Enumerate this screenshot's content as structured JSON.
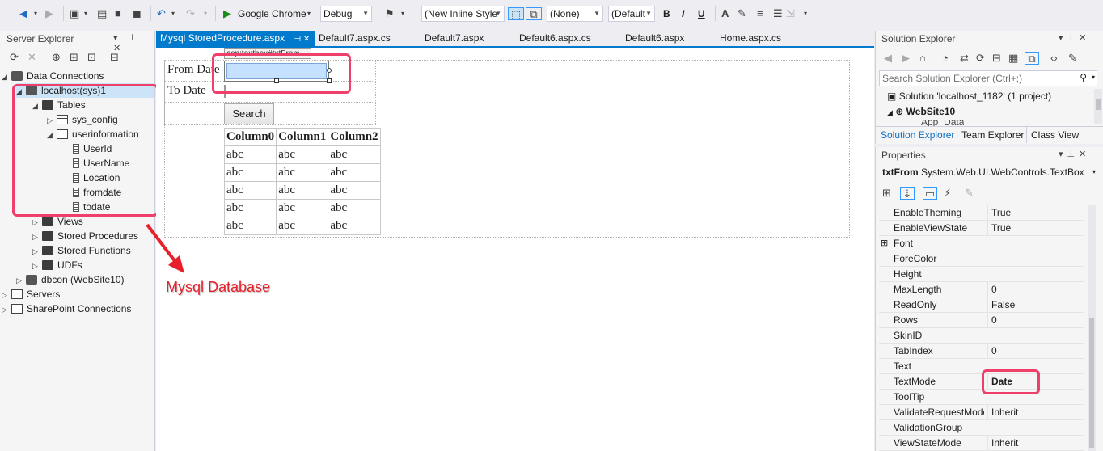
{
  "toolbar": {
    "browser": "Google Chrome",
    "config": "Debug",
    "style_combo": "(New Inline Style",
    "target_combo": "(None)",
    "font_combo": "(Default",
    "bold": "B",
    "italic": "I",
    "underline": "U"
  },
  "server_explorer": {
    "title": "Server Explorer",
    "pin_buttons": "▾ ⊥ ✕",
    "tree": [
      {
        "label": "Data Connections",
        "level": 0,
        "arrow": "◢",
        "icon": "database-connections-icon"
      },
      {
        "label": "localhost(sys)1",
        "level": 1,
        "arrow": "◢",
        "icon": "database-icon"
      },
      {
        "label": "Tables",
        "level": 2,
        "arrow": "◢",
        "icon": "folder-icon"
      },
      {
        "label": "sys_config",
        "level": 3,
        "arrow": "▷",
        "icon": "table-icon"
      },
      {
        "label": "userinformation",
        "level": 3,
        "arrow": "◢",
        "icon": "table-icon"
      },
      {
        "label": "UserId",
        "level": 4,
        "arrow": "",
        "icon": "column-icon"
      },
      {
        "label": "UserName",
        "level": 4,
        "arrow": "",
        "icon": "column-icon"
      },
      {
        "label": "Location",
        "level": 4,
        "arrow": "",
        "icon": "column-icon"
      },
      {
        "label": "fromdate",
        "level": 4,
        "arrow": "",
        "icon": "column-icon"
      },
      {
        "label": "todate",
        "level": 4,
        "arrow": "",
        "icon": "column-icon"
      },
      {
        "label": "Views",
        "level": 2,
        "arrow": "▷",
        "icon": "folder-icon"
      },
      {
        "label": "Stored Procedures",
        "level": 2,
        "arrow": "▷",
        "icon": "folder-icon"
      },
      {
        "label": "Stored Functions",
        "level": 2,
        "arrow": "▷",
        "icon": "folder-icon"
      },
      {
        "label": "UDFs",
        "level": 2,
        "arrow": "▷",
        "icon": "folder-icon"
      },
      {
        "label": "dbcon (WebSite10)",
        "level": 1,
        "arrow": "▷",
        "icon": "database-icon"
      },
      {
        "label": "Servers",
        "level": 0,
        "arrow": "▷",
        "icon": "server-icon"
      },
      {
        "label": "SharePoint Connections",
        "level": 0,
        "arrow": "▷",
        "icon": "sharepoint-icon"
      }
    ]
  },
  "tabs": [
    {
      "label": "Mysql StoredProcedure.aspx",
      "active": true,
      "pin": "⊣ ✕"
    },
    {
      "label": "Default7.aspx.cs"
    },
    {
      "label": "Default7.aspx"
    },
    {
      "label": "Default6.aspx.cs"
    },
    {
      "label": "Default6.aspx"
    },
    {
      "label": "Home.aspx.cs"
    }
  ],
  "designer": {
    "from_label": "From Date",
    "to_label": "To Date",
    "tag_tooltip": "asp:textbox#txtFrom",
    "search_button": "Search",
    "grid": {
      "headers": [
        "Column0",
        "Column1",
        "Column2"
      ],
      "rows": [
        [
          "abc",
          "abc",
          "abc"
        ],
        [
          "abc",
          "abc",
          "abc"
        ],
        [
          "abc",
          "abc",
          "abc"
        ],
        [
          "abc",
          "abc",
          "abc"
        ],
        [
          "abc",
          "abc",
          "abc"
        ]
      ]
    }
  },
  "annotation": "Mysql Database",
  "annotation_color": "#e8202a",
  "highlight_color": "#ef3f6b",
  "solution_explorer": {
    "title": "Solution Explorer",
    "search_placeholder": "Search Solution Explorer (Ctrl+;)",
    "solution_label": "Solution 'localhost_1182' (1 project)",
    "project_label": "WebSite10",
    "partial_label": "App_Data",
    "bottom_tabs": [
      "Solution Explorer",
      "Team Explorer",
      "Class View"
    ]
  },
  "properties": {
    "title": "Properties",
    "object_name": "txtFrom",
    "object_type": "System.Web.UI.WebControls.TextBox",
    "rows": [
      {
        "name": "EnableTheming",
        "value": "True"
      },
      {
        "name": "EnableViewState",
        "value": "True"
      },
      {
        "name": "Font",
        "value": "",
        "expand": true
      },
      {
        "name": "ForeColor",
        "value": ""
      },
      {
        "name": "Height",
        "value": ""
      },
      {
        "name": "MaxLength",
        "value": "0"
      },
      {
        "name": "ReadOnly",
        "value": "False"
      },
      {
        "name": "Rows",
        "value": "0"
      },
      {
        "name": "SkinID",
        "value": ""
      },
      {
        "name": "TabIndex",
        "value": "0"
      },
      {
        "name": "Text",
        "value": ""
      },
      {
        "name": "TextMode",
        "value": "Date",
        "bold": true
      },
      {
        "name": "ToolTip",
        "value": ""
      },
      {
        "name": "ValidateRequestMode",
        "value": "Inherit"
      },
      {
        "name": "ValidationGroup",
        "value": ""
      },
      {
        "name": "ViewStateMode",
        "value": "Inherit"
      }
    ]
  },
  "colors": {
    "accent": "#007acc",
    "selection": "#c4e1ff"
  }
}
